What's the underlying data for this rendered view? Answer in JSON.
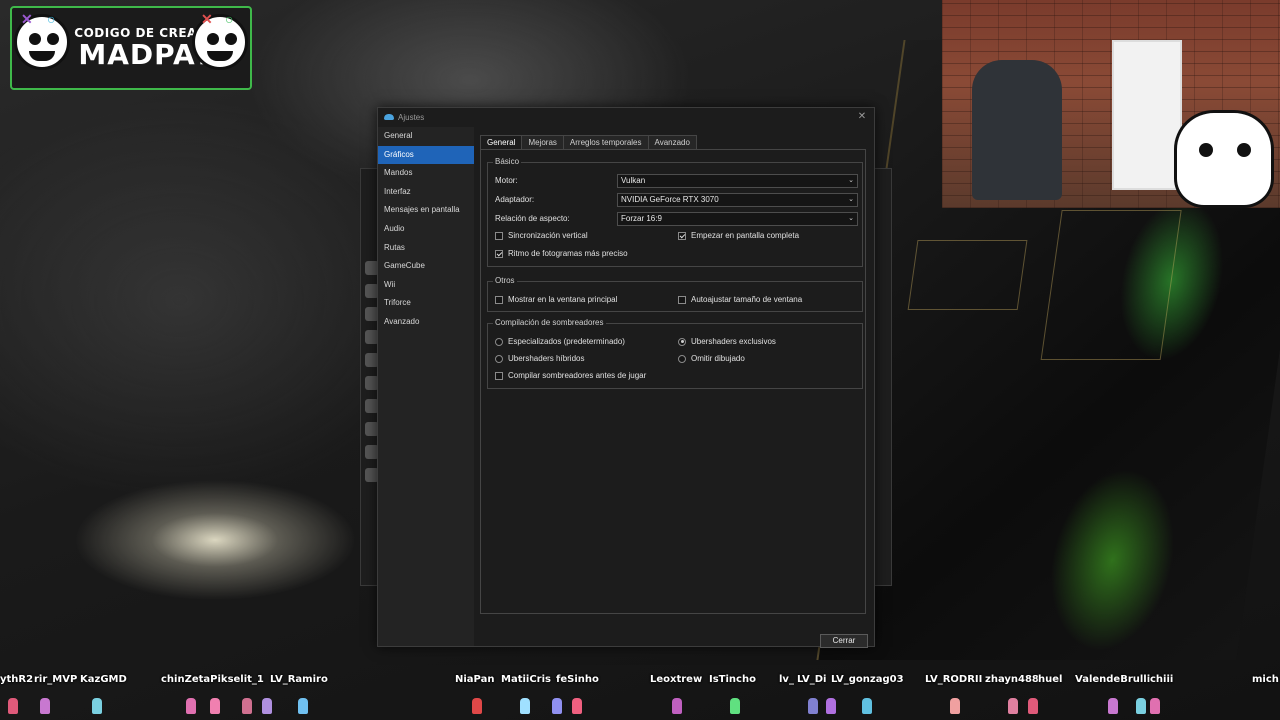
{
  "overlay": {
    "logo_subtitle": "CODIGO DE CREADOR",
    "logo_title": "MADPAT"
  },
  "dialog": {
    "title": "Ajustes",
    "close_glyph": "✕",
    "sidebar": [
      "General",
      "Gráficos",
      "Mandos",
      "Interfaz",
      "Mensajes en pantalla",
      "Audio",
      "Rutas",
      "GameCube",
      "Wii",
      "Triforce",
      "Avanzado"
    ],
    "active_sidebar": "Gráficos",
    "tabs": [
      "General",
      "Mejoras",
      "Arreglos temporales",
      "Avanzado"
    ],
    "active_tab": "General",
    "basic": {
      "title": "Básico",
      "motor_label": "Motor:",
      "motor_value": "Vulkan",
      "adapter_label": "Adaptador:",
      "adapter_value": "NVIDIA GeForce RTX 3070",
      "aspect_label": "Relación de aspecto:",
      "aspect_value": "Forzar 16:9",
      "vsync": {
        "label": "Sincronización vertical",
        "checked": false
      },
      "fullscreen": {
        "label": "Empezar en pantalla completa",
        "checked": true
      },
      "precise_frames": {
        "label": "Ritmo de fotogramas más preciso",
        "checked": true
      }
    },
    "others": {
      "title": "Otros",
      "main_window": {
        "label": "Mostrar en la ventana principal",
        "checked": false
      },
      "auto_resize": {
        "label": "Autoajustar tamaño de ventana",
        "checked": false
      }
    },
    "shaders": {
      "title": "Compilación de sombreadores",
      "specialized": {
        "label": "Especializados (predeterminado)",
        "selected": false
      },
      "exclusive": {
        "label": "Ubershaders exclusivos",
        "selected": true
      },
      "hybrid": {
        "label": "Ubershaders híbridos",
        "selected": false
      },
      "skip_draw": {
        "label": "Omitir dibujado",
        "selected": false
      },
      "compile_before": {
        "label": "Compilar sombreadores antes de jugar",
        "checked": false
      }
    },
    "close_button": "Cerrar"
  },
  "viewers": {
    "names": [
      "ythR2",
      "rir_MVP",
      "KazGMD",
      "chinZetaPikselit_1",
      "LV_Ramiro",
      "NiaPan",
      "MatiiCris",
      "feSinho",
      "Leoxtrew",
      "IsTincho",
      "lv_",
      "LV_Di",
      "LV_gonzag03",
      "LV_RODRII",
      "zhayn488",
      "huel",
      "ValendeBrulli",
      "chiii",
      "mich"
    ],
    "colors": [
      "#e05a7a",
      "#c878d0",
      "#7ad0e0",
      "#e070b0",
      "#f080b0",
      "#d07090",
      "#b090e0",
      "#70c0f0",
      "#e04848",
      "#a0e0ff",
      "#9090f0",
      "#f06080",
      "#c060c0",
      "#60e080",
      "#8080d0",
      "#b070e0",
      "#60c0e0",
      "#f0a0a0",
      "#e080a0"
    ]
  }
}
